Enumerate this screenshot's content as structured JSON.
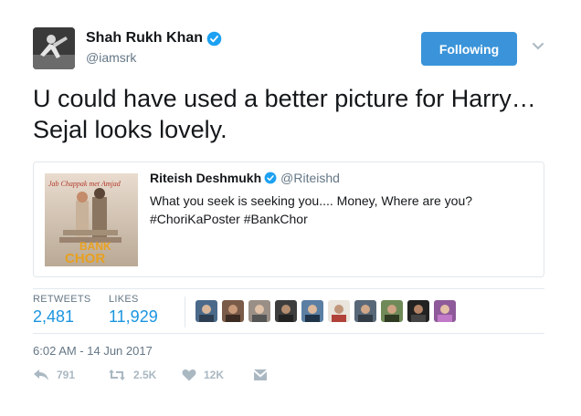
{
  "author": {
    "display_name": "Shah Rukh Khan",
    "handle": "@iamsrk",
    "verified": true
  },
  "follow_button": {
    "label": "Following"
  },
  "tweet": {
    "text": "U could have used a better picture for Harry…Sejal looks lovely."
  },
  "quoted_tweet": {
    "display_name": "Riteish Deshmukh",
    "handle": "@Riteishd",
    "text_line1": "What you seek is seeking you.... Money, Where are you?",
    "text_line2": "#ChoriKaPoster #BankChor",
    "image": {
      "poster_text_top": "Jab Chappak met Amjad",
      "poster_title_1": "BANK",
      "poster_title_2": "CHOR"
    }
  },
  "stats": {
    "retweets_label": "RETWEETS",
    "retweets_value": "2,481",
    "likes_label": "LIKES",
    "likes_value": "11,929"
  },
  "timestamp": "6:02 AM - 14 Jun 2017",
  "actions": {
    "reply_count": "791",
    "retweet_count": "2.5K",
    "like_count": "12K"
  },
  "colors": {
    "accent": "#1b95e0",
    "follow_button": "#3b94d9",
    "verified": "#1da1f2",
    "muted": "#657786",
    "action_gray": "#aab8c2"
  }
}
